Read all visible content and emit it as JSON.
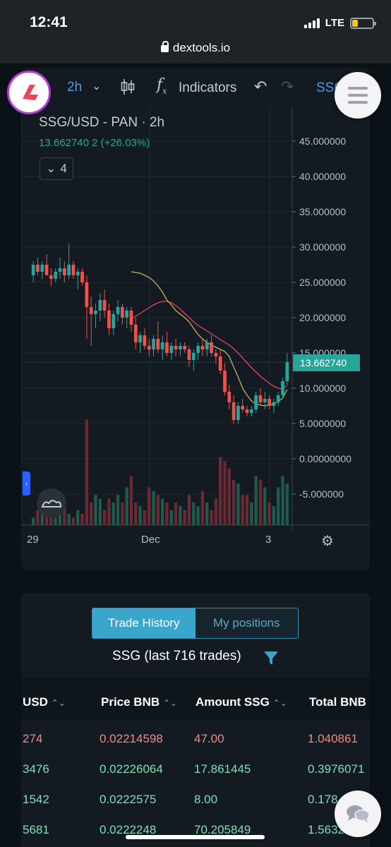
{
  "status": {
    "time": "12:41",
    "network": "LTE",
    "url": "dextools.io",
    "battery_level": 0.3
  },
  "toolbar": {
    "interval": "2h",
    "indicators_label": "Indicators",
    "symbol_short": "SSG"
  },
  "chart_legend": {
    "title": "SSG/USD - PAN · 2h",
    "price_change": "13.662740 2 (+26.03%)",
    "indicator_count": "4"
  },
  "price_tag": "13.662740",
  "chart_data": {
    "type": "candlestick",
    "title": "SSG/USD - PAN · 2h",
    "ylim": [
      -9.5,
      47.5
    ],
    "y_ticks": [
      "45.000000",
      "40.000000",
      "35.000000",
      "30.000000",
      "25.000000",
      "20.000000",
      "15.000000",
      "10.000000",
      "5.0000000",
      "0.00000000",
      "-5.000000"
    ],
    "y_tick_values": [
      45,
      40,
      35,
      30,
      25,
      20,
      15,
      10,
      5,
      0,
      -5
    ],
    "x_tick_labels": [
      "29",
      "Dec",
      "3"
    ],
    "last_price": 13.66274,
    "candles": [
      [
        26,
        28,
        25,
        27.5
      ],
      [
        27.5,
        28.5,
        26,
        26.5
      ],
      [
        26.5,
        28,
        25.5,
        27.5
      ],
      [
        27.5,
        29,
        26,
        26
      ],
      [
        26,
        27,
        24.5,
        25.5
      ],
      [
        25.5,
        27,
        25,
        26.5
      ],
      [
        26.5,
        28.5,
        25.5,
        27
      ],
      [
        27,
        28,
        25,
        26
      ],
      [
        26,
        30.5,
        25.5,
        27.5
      ],
      [
        27.5,
        28,
        25.5,
        26
      ],
      [
        26,
        27,
        24,
        26.5
      ],
      [
        26.5,
        27,
        24.5,
        25
      ],
      [
        25,
        26,
        17,
        21.5
      ],
      [
        21.5,
        23,
        16,
        20.5
      ],
      [
        20.5,
        22,
        18.5,
        21
      ],
      [
        21,
        23.5,
        19.5,
        22.5
      ],
      [
        22.5,
        24,
        20,
        21
      ],
      [
        21,
        22,
        17.5,
        18.5
      ],
      [
        18.5,
        21,
        17.5,
        20.5
      ],
      [
        20.5,
        22.5,
        19.5,
        21.5
      ],
      [
        21.5,
        22,
        19,
        20
      ],
      [
        20,
        21.5,
        18.5,
        21
      ],
      [
        21,
        21.5,
        18,
        19
      ],
      [
        19,
        20,
        15.5,
        16.5
      ],
      [
        16.5,
        18,
        15,
        17.5
      ],
      [
        17.5,
        18.5,
        15.5,
        16
      ],
      [
        16,
        17,
        14.5,
        15.5
      ],
      [
        15.5,
        17.5,
        14.5,
        17
      ],
      [
        17,
        19.5,
        15,
        15.5
      ],
      [
        15.5,
        17.5,
        14,
        16.5
      ],
      [
        16.5,
        18,
        14.5,
        15
      ],
      [
        15,
        16.5,
        14,
        16
      ],
      [
        16,
        17,
        14.5,
        15.5
      ],
      [
        15.5,
        16.5,
        14.5,
        16
      ],
      [
        16,
        16.5,
        15,
        15.5
      ],
      [
        15.5,
        16,
        13,
        14
      ],
      [
        14,
        15.5,
        12.5,
        15
      ],
      [
        15,
        16.5,
        14,
        16
      ],
      [
        16,
        17,
        14.5,
        15.5
      ],
      [
        15.5,
        17,
        14.5,
        16.5
      ],
      [
        16.5,
        17.5,
        14.5,
        15
      ],
      [
        15,
        15.5,
        13.5,
        14.5
      ],
      [
        14.5,
        15.5,
        12,
        12.5
      ],
      [
        12.5,
        13.5,
        9,
        9.5
      ],
      [
        9.5,
        10.5,
        7,
        8
      ],
      [
        8,
        9,
        5,
        5.5
      ],
      [
        5.5,
        8,
        5,
        7.5
      ],
      [
        7.5,
        8.5,
        6.5,
        7
      ],
      [
        7,
        7.5,
        6,
        6.5
      ],
      [
        6.5,
        7.5,
        6,
        7
      ],
      [
        7,
        9.5,
        6.5,
        9
      ],
      [
        9,
        10,
        7.5,
        8
      ],
      [
        8,
        9.5,
        7,
        8.5
      ],
      [
        8.5,
        9,
        7,
        7.5
      ],
      [
        7.5,
        8.5,
        6.5,
        8
      ],
      [
        8,
        9.5,
        7.5,
        9
      ],
      [
        9,
        11.5,
        8.5,
        11
      ],
      [
        11,
        15,
        10.5,
        13.7
      ]
    ],
    "volume": [
      1,
      2,
      1.5,
      2.5,
      2,
      1,
      2,
      2.5,
      1.5,
      1,
      2,
      1.5,
      14,
      3,
      4,
      3.5,
      2,
      3.5,
      3,
      4,
      3,
      5,
      6.5,
      3,
      2.5,
      2,
      5,
      4.5,
      4,
      3.5,
      3,
      2,
      3,
      2.5,
      2,
      4,
      3,
      2.5,
      4.5,
      3,
      2,
      3.5,
      9,
      8.5,
      7.5,
      6,
      5.5,
      4,
      4,
      3,
      6.5,
      6,
      5,
      3,
      2.5,
      5,
      6.5,
      5.5
    ],
    "ma_fast": [
      26.5,
      26.4,
      26.3,
      26,
      25.7,
      25.2,
      24.5,
      23.6,
      22.5,
      21.8,
      21,
      20.5,
      20,
      19.4,
      18.5,
      17.6,
      17,
      16.5,
      16.1,
      15.8,
      15.5,
      15.2,
      14.5,
      13,
      11.6,
      10,
      9,
      8.2,
      7.8,
      7.6,
      7.5,
      7.6,
      7.8,
      8.1,
      8.6,
      9.8
    ],
    "ma_slow": [
      19.8,
      20.2,
      20.6,
      21,
      21.4,
      21.8,
      22.1,
      22.3,
      22.3,
      22.1,
      21.7,
      21.2,
      20.6,
      20,
      19.4,
      18.9,
      18.5,
      18.1,
      17.7,
      17.3,
      16.9,
      16.5,
      16.1,
      15.6,
      15,
      14.3,
      13.6,
      12.9,
      12.3,
      11.7,
      11.2,
      10.7,
      10.3,
      10,
      9.9,
      10.4
    ]
  },
  "trades": {
    "tab_active": "Trade History",
    "tab_inactive": "My positions",
    "title": "SSG (last 716 trades)",
    "columns": [
      "USD",
      "Price BNB",
      "Amount SSG",
      "Total BNB"
    ],
    "rows": [
      {
        "usd": "274",
        "price_bnb": "0.02214598",
        "amount": "47.00",
        "total": "1.040861",
        "side": "sell"
      },
      {
        "usd": "3476",
        "price_bnb": "0.02226064",
        "amount": "17.861445",
        "total": "0.3976071",
        "side": "buy"
      },
      {
        "usd": "1542",
        "price_bnb": "0.0222575",
        "amount": "8.00",
        "total": "0.178",
        "side": "buy"
      },
      {
        "usd": "5681",
        "price_bnb": "0.0222248",
        "amount": "70.205849",
        "total": "1.5632746",
        "side": "buy"
      }
    ]
  }
}
